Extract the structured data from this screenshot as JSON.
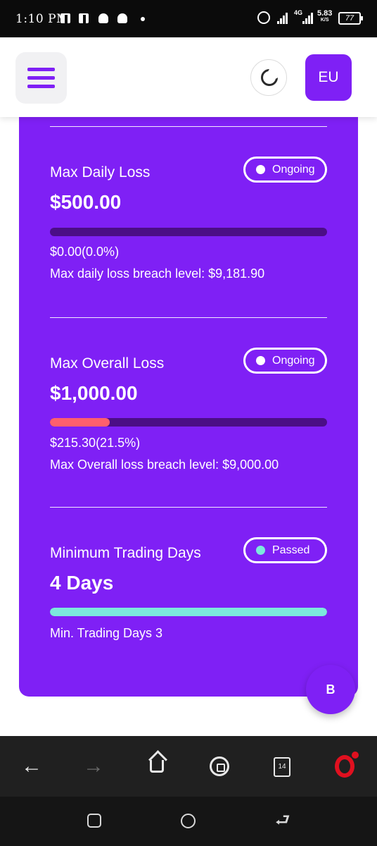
{
  "status_bar": {
    "time": "1:10 PM",
    "network": "4G",
    "speed_value": "5.83",
    "speed_unit": "K/S",
    "battery": "77"
  },
  "header": {
    "user_initials": "EU",
    "icons": {
      "menu": "hamburger-icon",
      "theme": "moon-icon"
    }
  },
  "sections": [
    {
      "title": "Max Daily Loss",
      "value": "$500.00",
      "status": "Ongoing",
      "status_color": "#ffffff",
      "progress": 0.0,
      "progress_color": "#ff5f6d",
      "detail_1": "$0.00(0.0%)",
      "detail_2": "Max daily loss breach level: $9,181.90"
    },
    {
      "title": "Max Overall Loss",
      "value": "$1,000.00",
      "status": "Ongoing",
      "status_color": "#ffffff",
      "progress": 0.215,
      "progress_color": "#ff5f6d",
      "detail_1": "$215.30(21.5%)",
      "detail_2": "Max Overall loss breach level: $9,000.00"
    },
    {
      "title": "Minimum Trading Days",
      "value": "4 Days",
      "status": "Passed",
      "status_color": "#7ce8dd",
      "progress": 1.0,
      "progress_color": "#7ce8dd",
      "detail_1": "Min. Trading Days 3"
    }
  ],
  "fab": {
    "label": "B"
  },
  "browser_bar": {
    "tab_count": "14",
    "icons": [
      "back-arrow-icon",
      "forward-arrow-icon",
      "home-icon",
      "soccer-ball-icon",
      "tabs-icon",
      "opera-icon"
    ]
  },
  "colors": {
    "brand": "#7f20f5",
    "track": "#4b0e86",
    "loss": "#ff5f6d",
    "passed": "#7ce8dd"
  }
}
